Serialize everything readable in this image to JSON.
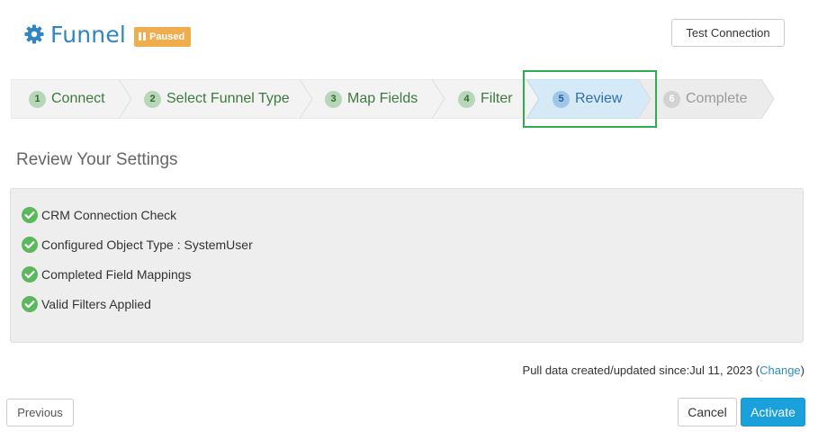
{
  "header": {
    "brand": "Funnel",
    "gear_icon": "gear-icon",
    "badge": "Paused",
    "brand_color": "#2f86c2",
    "badge_color": "#f0ad4e"
  },
  "actions": {
    "test_connection": "Test Connection",
    "previous": "Previous",
    "cancel": "Cancel",
    "activate": "Activate"
  },
  "wizard": {
    "steps": [
      {
        "num": "1",
        "label": "Connect",
        "state": "done"
      },
      {
        "num": "2",
        "label": "Select Funnel Type",
        "state": "done"
      },
      {
        "num": "3",
        "label": "Map Fields",
        "state": "done"
      },
      {
        "num": "4",
        "label": "Filter",
        "state": "done"
      },
      {
        "num": "5",
        "label": "Review",
        "state": "active"
      },
      {
        "num": "6",
        "label": "Complete",
        "state": "todo"
      }
    ]
  },
  "review": {
    "title": "Review Your Settings",
    "checks": [
      "CRM Connection Check",
      "Configured Object Type : SystemUser",
      "Completed Field Mappings",
      "Valid Filters Applied"
    ]
  },
  "pull": {
    "text": "Pull data created/updated since:Jul 11, 2023",
    "open_paren": "(",
    "link": "Change",
    "close_paren": ")"
  },
  "colors": {
    "accent": "#1aa0db",
    "success": "#5cb85c",
    "highlight_border": "#2fac4d"
  }
}
